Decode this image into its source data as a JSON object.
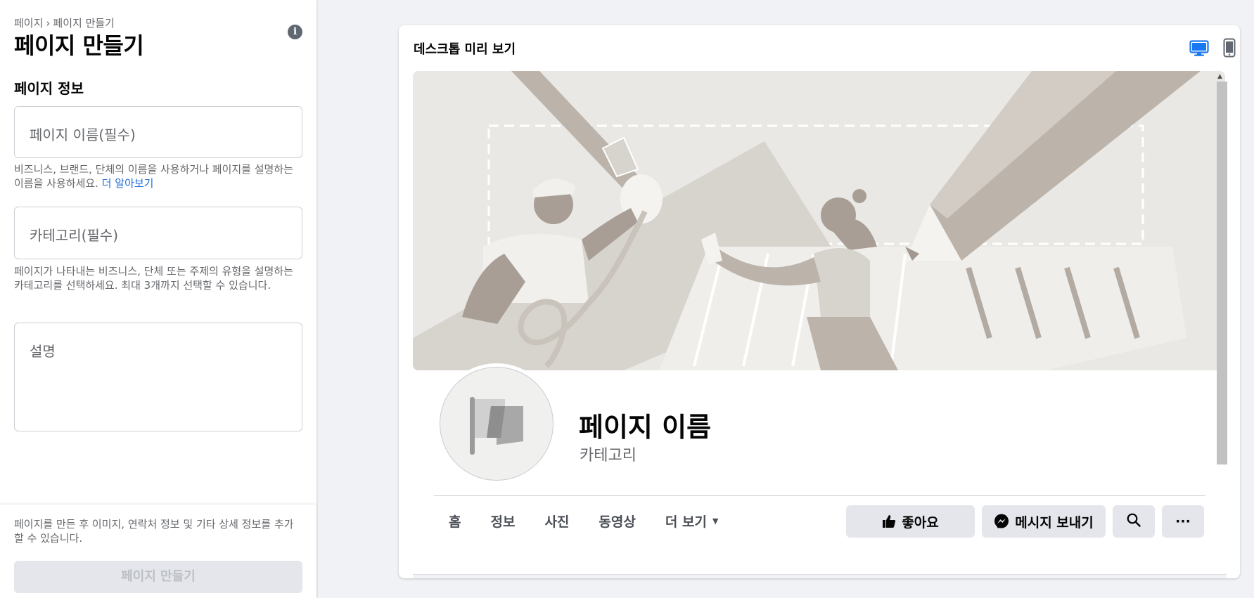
{
  "left": {
    "breadcrumb": [
      "페이지",
      "페이지 만들기"
    ],
    "breadcrumb_sep": "›",
    "title": "페이지 만들기",
    "info_icon": "i",
    "section_title": "페이지 정보",
    "name_field": {
      "placeholder": "페이지 이름(필수)"
    },
    "name_help": "비즈니스, 브랜드, 단체의 이름을 사용하거나 페이지를 설명하는 이름을 사용하세요.",
    "name_help_link": "더 알아보기",
    "category_field": {
      "placeholder": "카테고리(필수)"
    },
    "category_help": "페이지가 나타내는 비즈니스, 단체 또는 주제의 유형을 설명하는 카테고리를 선택하세요. 최대 3개까지 선택할 수 있습니다.",
    "description_field": {
      "placeholder": "설명"
    },
    "bottom_note": "페이지를 만든 후 이미지, 연락처 정보 및 기타 상세 정보를 추가할 수 있습니다.",
    "create_button": "페이지 만들기"
  },
  "preview": {
    "title": "데스크톱 미리 보기",
    "device_icons": [
      "desktop-icon",
      "mobile-icon"
    ],
    "active_device": "desktop",
    "page_name": "페이지 이름",
    "category": "카테고리",
    "tabs": [
      "홈",
      "정보",
      "사진",
      "동영상",
      "더 보기"
    ],
    "more_caret": "▼",
    "actions": {
      "like": "좋아요",
      "message": "메시지 보내기",
      "more": "···"
    }
  },
  "colors": {
    "accent": "#1877f2",
    "link": "#216fdb",
    "button_bg": "#e4e6eb",
    "disabled_text": "#bcc0c4"
  }
}
